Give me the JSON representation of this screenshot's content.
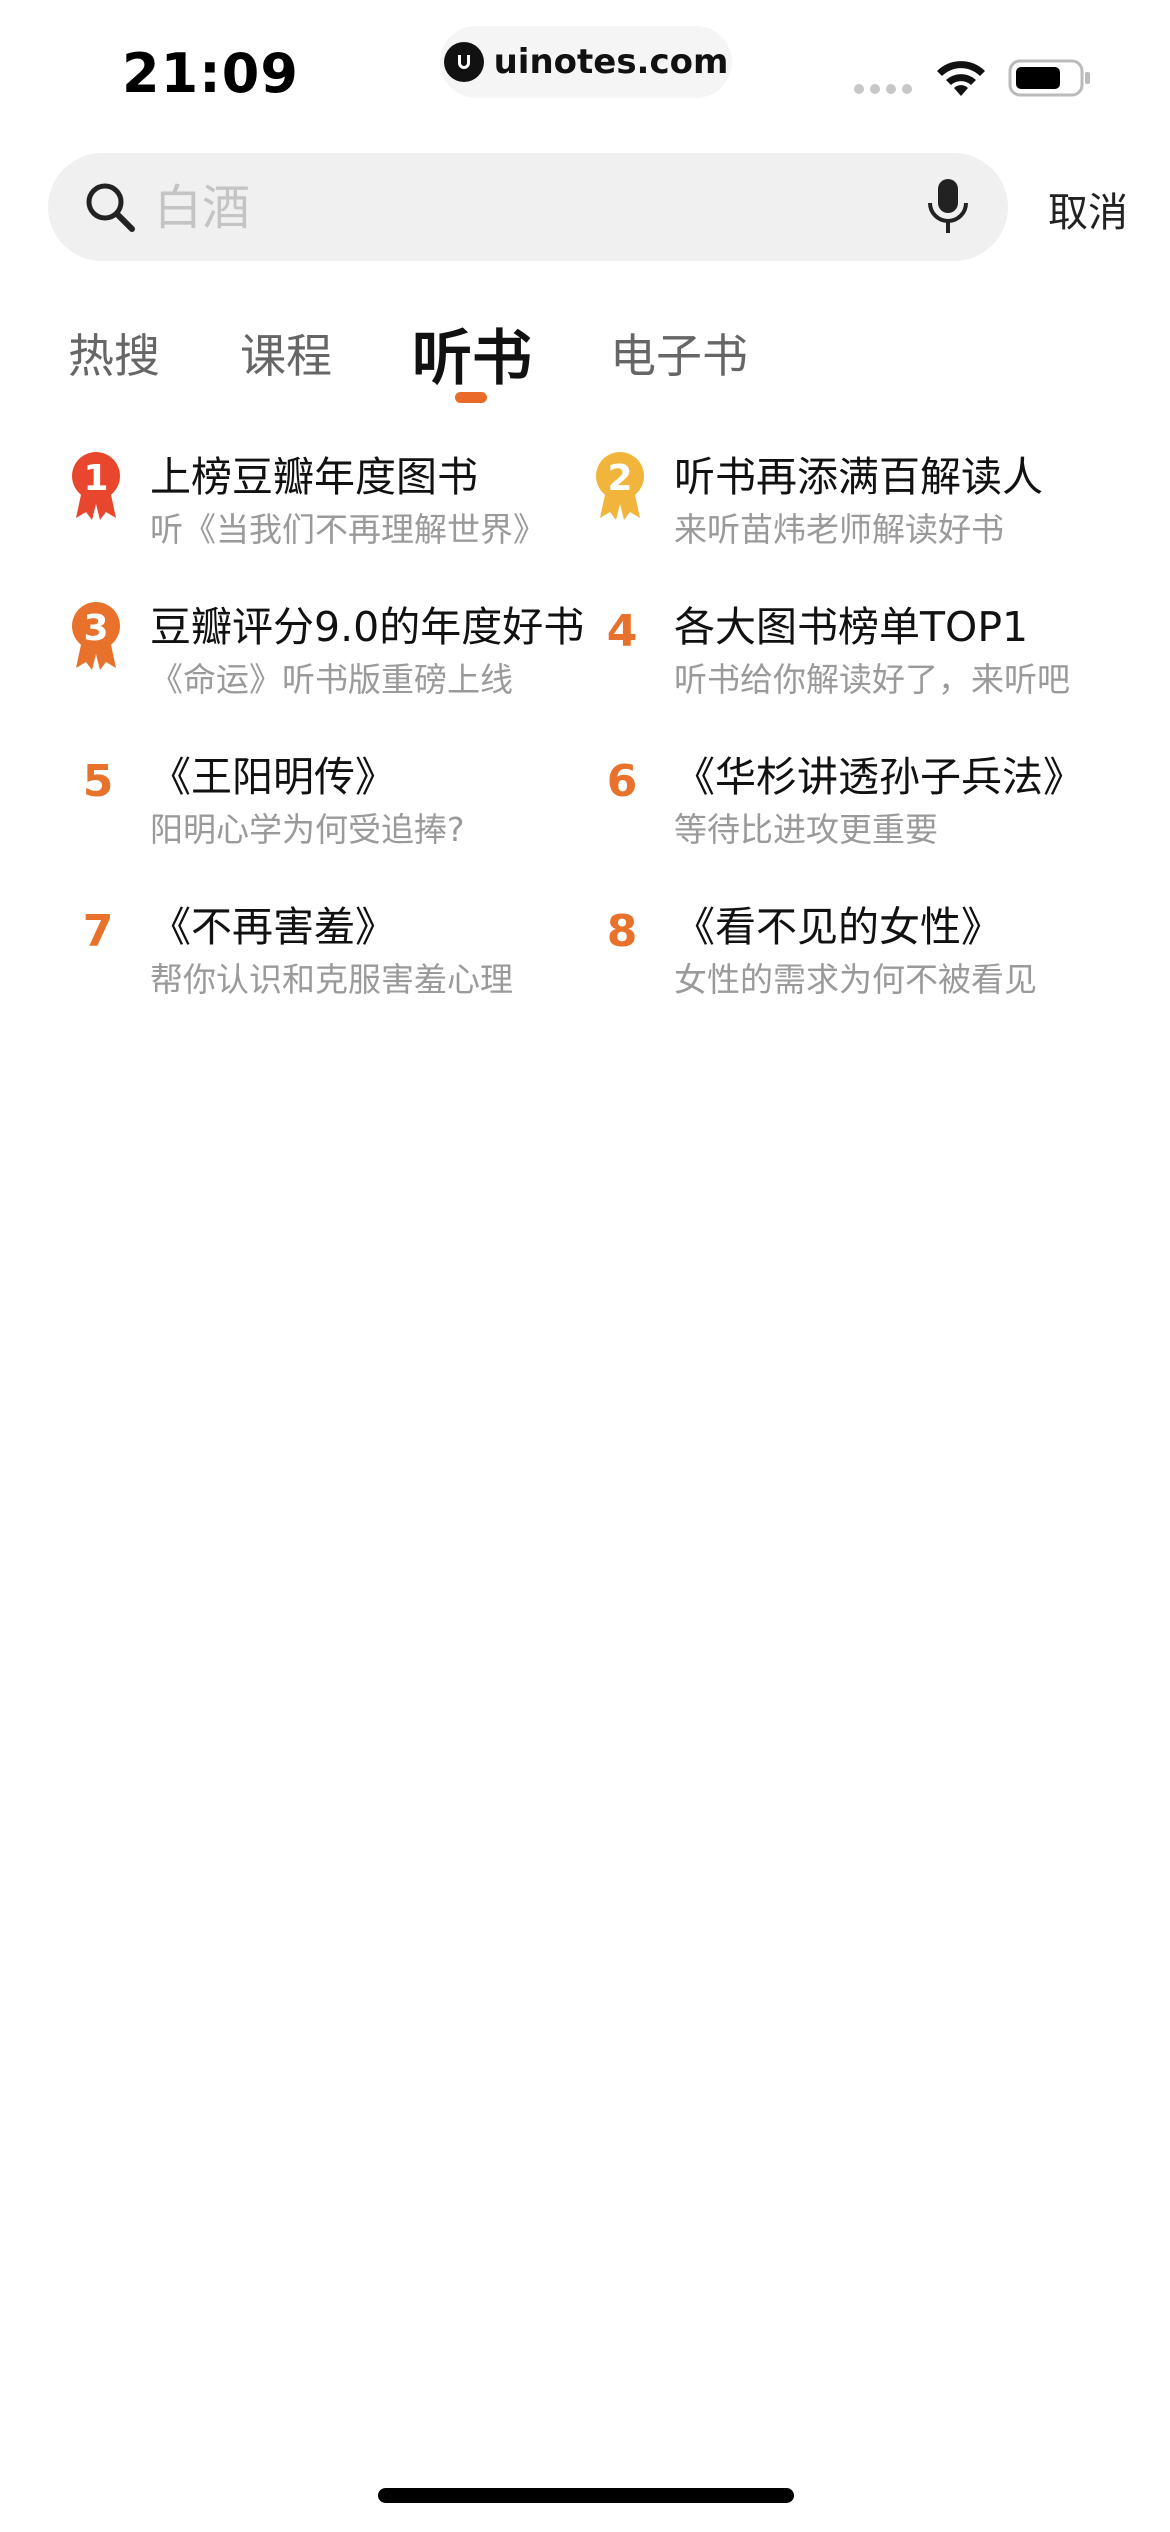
{
  "status_bar": {
    "time": "21:09",
    "url": "uinotes.com"
  },
  "search": {
    "placeholder": "白酒",
    "cancel_label": "取消"
  },
  "tabs": [
    {
      "label": "热搜",
      "active": false
    },
    {
      "label": "课程",
      "active": false
    },
    {
      "label": "听书",
      "active": true
    },
    {
      "label": "电子书",
      "active": false
    }
  ],
  "colors": {
    "accent": "#ea6a2a",
    "rank1": "#e8472e",
    "rank2": "#f1b53b",
    "rank3": "#e8722c"
  },
  "hot_list": [
    {
      "rank": "1",
      "title": "上榜豆瓣年度图书",
      "subtitle": "听《当我们不再理解世界》"
    },
    {
      "rank": "2",
      "title": "听书再添满百解读人",
      "subtitle": "来听苗炜老师解读好书"
    },
    {
      "rank": "3",
      "title": "豆瓣评分9.0的年度好书",
      "subtitle": "《命运》听书版重磅上线"
    },
    {
      "rank": "4",
      "title": "各大图书榜单TOP1",
      "subtitle": "听书给你解读好了，来听吧"
    },
    {
      "rank": "5",
      "title": "《王阳明传》",
      "subtitle": "阳明心学为何受追捧?"
    },
    {
      "rank": "6",
      "title": "《华杉讲透孙子兵法》",
      "subtitle": "等待比进攻更重要"
    },
    {
      "rank": "7",
      "title": "《不再害羞》",
      "subtitle": "帮你认识和克服害羞心理"
    },
    {
      "rank": "8",
      "title": "《看不见的女性》",
      "subtitle": "女性的需求为何不被看见"
    }
  ]
}
